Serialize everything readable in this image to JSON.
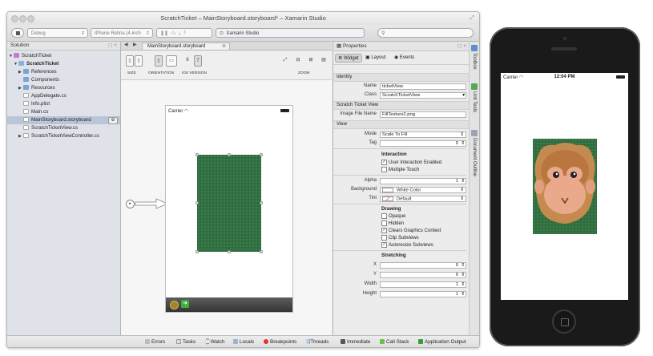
{
  "window": {
    "title": "ScratchTicket – MainStoryboard.storyboard* – Xamarin Studio"
  },
  "toolbar": {
    "config": "Debug",
    "device": "iPhone Retina (4-inch",
    "status": "Xamarin Studio"
  },
  "solution_pad": {
    "title": "Solution",
    "items": [
      {
        "label": "ScratchTicket"
      },
      {
        "label": "ScratchTicket"
      },
      {
        "label": "References"
      },
      {
        "label": "Components"
      },
      {
        "label": "Resources"
      },
      {
        "label": "AppDelegate.cs"
      },
      {
        "label": "Info.plist"
      },
      {
        "label": "Main.cs"
      },
      {
        "label": "MainStoryboard.storyboard"
      },
      {
        "label": "ScratchTicketView.cs"
      },
      {
        "label": "ScratchTicketViewController.cs"
      }
    ]
  },
  "editor": {
    "tab_label": "MainStoryboard.storyboard",
    "size_label": "SIZE",
    "orientation_label": "ORIENTATION",
    "ios_version_label": "iOS VERSION",
    "ios6": "6",
    "ios7": "7",
    "zoom_label": "ZOOM",
    "carrier": "Carrier"
  },
  "properties": {
    "title": "Properties",
    "tabs": {
      "widget": "Widget",
      "layout": "Layout",
      "events": "Events"
    },
    "identity_header": "Identity",
    "name_label": "Name",
    "name_value": "ticketView",
    "class_label": "Class",
    "class_value": "ScratchTicketView",
    "scratch_header": "Scratch Ticket View",
    "image_file_label": "Image File Name",
    "image_file_value": "FillTexture2.png",
    "view_header": "View",
    "mode_label": "Mode",
    "mode_value": "Scale To Fill",
    "tag_label": "Tag",
    "tag_value": "0",
    "interaction_header": "Interaction",
    "user_interaction": "User Interaction Enabled",
    "multiple_touch": "Multiple Touch",
    "alpha_label": "Alpha",
    "alpha_value": "1",
    "background_label": "Background",
    "background_value": "White Color",
    "tint_label": "Tint",
    "tint_value": "Default",
    "drawing_header": "Drawing",
    "opaque": "Opaque",
    "hidden": "Hidden",
    "clears_graphics": "Clears Graphics Context",
    "clip_subviews": "Clip Subviews",
    "autoresize": "Autoresize Subviews",
    "stretching_header": "Stretching",
    "x_label": "X",
    "x_value": "0",
    "y_label": "Y",
    "y_value": "0",
    "width_label": "Width",
    "width_value": "1",
    "height_label": "Height",
    "height_value": "1"
  },
  "side_tabs": {
    "toolbox": "Toolbox",
    "unit_tests": "Unit Tests",
    "doc_outline": "Document Outline"
  },
  "statusbar": {
    "errors": "Errors",
    "tasks": "Tasks",
    "watch": "Watch",
    "locals": "Locals",
    "breakpoints": "Breakpoints",
    "threads": "Threads",
    "immediate": "Immediate",
    "call_stack": "Call Stack",
    "app_output": "Application Output"
  },
  "simulator": {
    "carrier": "Carrier",
    "time": "12:04 PM"
  },
  "colors": {
    "scratch_green": "#2f6b3e",
    "selection": "#b8c6d8"
  }
}
